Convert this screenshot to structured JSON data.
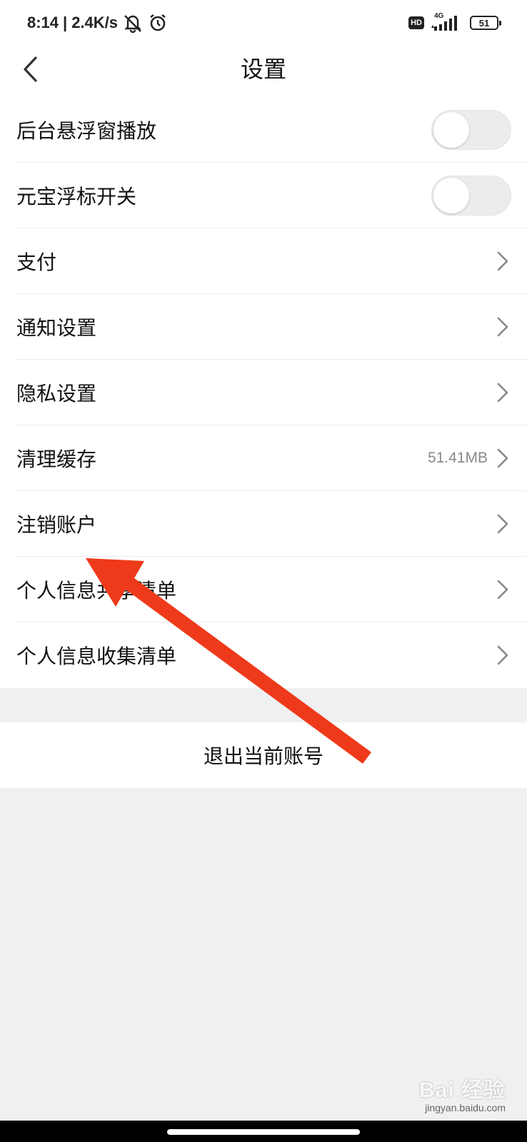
{
  "status_bar": {
    "time": "8:14",
    "net_speed": "2.4K/s",
    "hd": "HD",
    "network": "4G",
    "battery": "51"
  },
  "nav": {
    "title": "设置"
  },
  "settings": {
    "items": [
      {
        "label": "后台悬浮窗播放",
        "type": "toggle",
        "on": false
      },
      {
        "label": "元宝浮标开关",
        "type": "toggle",
        "on": false
      },
      {
        "label": "支付",
        "type": "link"
      },
      {
        "label": "通知设置",
        "type": "link"
      },
      {
        "label": "隐私设置",
        "type": "link"
      },
      {
        "label": "清理缓存",
        "type": "link",
        "value": "51.41MB"
      },
      {
        "label": "注销账户",
        "type": "link"
      },
      {
        "label": "个人信息共享清单",
        "type": "link"
      },
      {
        "label": "个人信息收集清单",
        "type": "link"
      }
    ]
  },
  "logout": {
    "label": "退出当前账号"
  },
  "annotation": {
    "arrow_color": "#ee3a1b"
  },
  "watermark": {
    "logo": "Bai 经验",
    "url": "jingyan.baidu.com"
  }
}
